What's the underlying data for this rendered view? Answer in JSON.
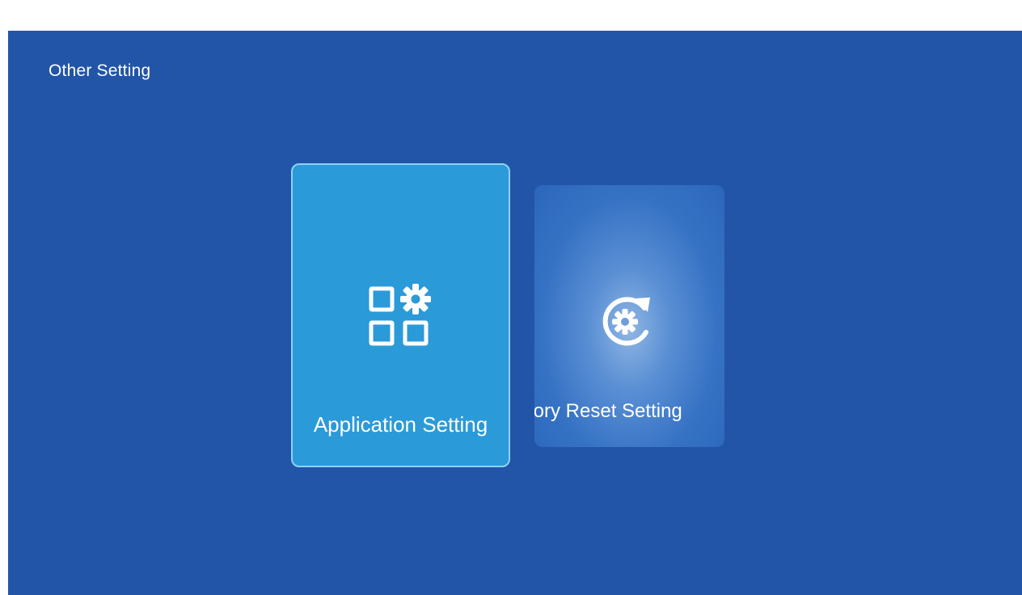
{
  "header": {
    "title": "Other Setting"
  },
  "cards": [
    {
      "label": "Application Setting",
      "icon": "app-settings-icon",
      "focused": true
    },
    {
      "label": "Factory Reset Setting",
      "icon": "factory-reset-icon",
      "focused": false
    }
  ],
  "colors": {
    "background": "#2255a8",
    "focused_card": "#2b9ad8",
    "focused_border": "#8fd2f5",
    "text": "#ffffff"
  }
}
